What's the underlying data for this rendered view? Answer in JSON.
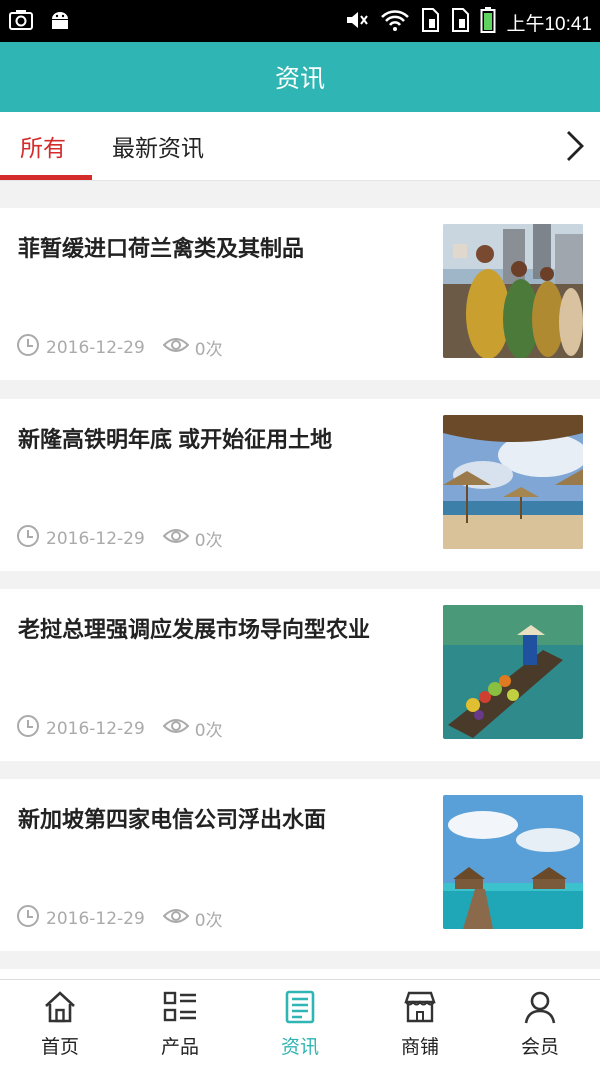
{
  "status_bar": {
    "time": "上午10:41",
    "icons": [
      "camera-icon",
      "android-icon",
      "mute-icon",
      "wifi-icon",
      "sim1-icon",
      "sim2-icon",
      "battery-icon"
    ]
  },
  "header": {
    "title": "资讯"
  },
  "tabs": [
    {
      "label": "所有",
      "active": true
    },
    {
      "label": "最新资讯",
      "active": false
    }
  ],
  "news": [
    {
      "title": "菲暂缓进口荷兰禽类及其制品",
      "date": "2016-12-29",
      "views": "0次",
      "image": "festival-parade"
    },
    {
      "title": "新隆高铁明年底 或开始征用土地",
      "date": "2016-12-29",
      "views": "0次",
      "image": "beach-umbrellas"
    },
    {
      "title": "老挝总理强调应发展市场导向型农业",
      "date": "2016-12-29",
      "views": "0次",
      "image": "fruit-boat"
    },
    {
      "title": "新加坡第四家电信公司浮出水面",
      "date": "2016-12-29",
      "views": "0次",
      "image": "sea-pier"
    }
  ],
  "bottom_nav": [
    {
      "label": "首页",
      "icon": "home-icon",
      "active": false
    },
    {
      "label": "产品",
      "icon": "list-icon",
      "active": false
    },
    {
      "label": "资讯",
      "icon": "news-icon",
      "active": true
    },
    {
      "label": "商铺",
      "icon": "shop-icon",
      "active": false
    },
    {
      "label": "会员",
      "icon": "user-icon",
      "active": false
    }
  ],
  "colors": {
    "primary": "#2fb5b3",
    "accent": "#d42b2b",
    "meta": "#aaaaaa"
  }
}
